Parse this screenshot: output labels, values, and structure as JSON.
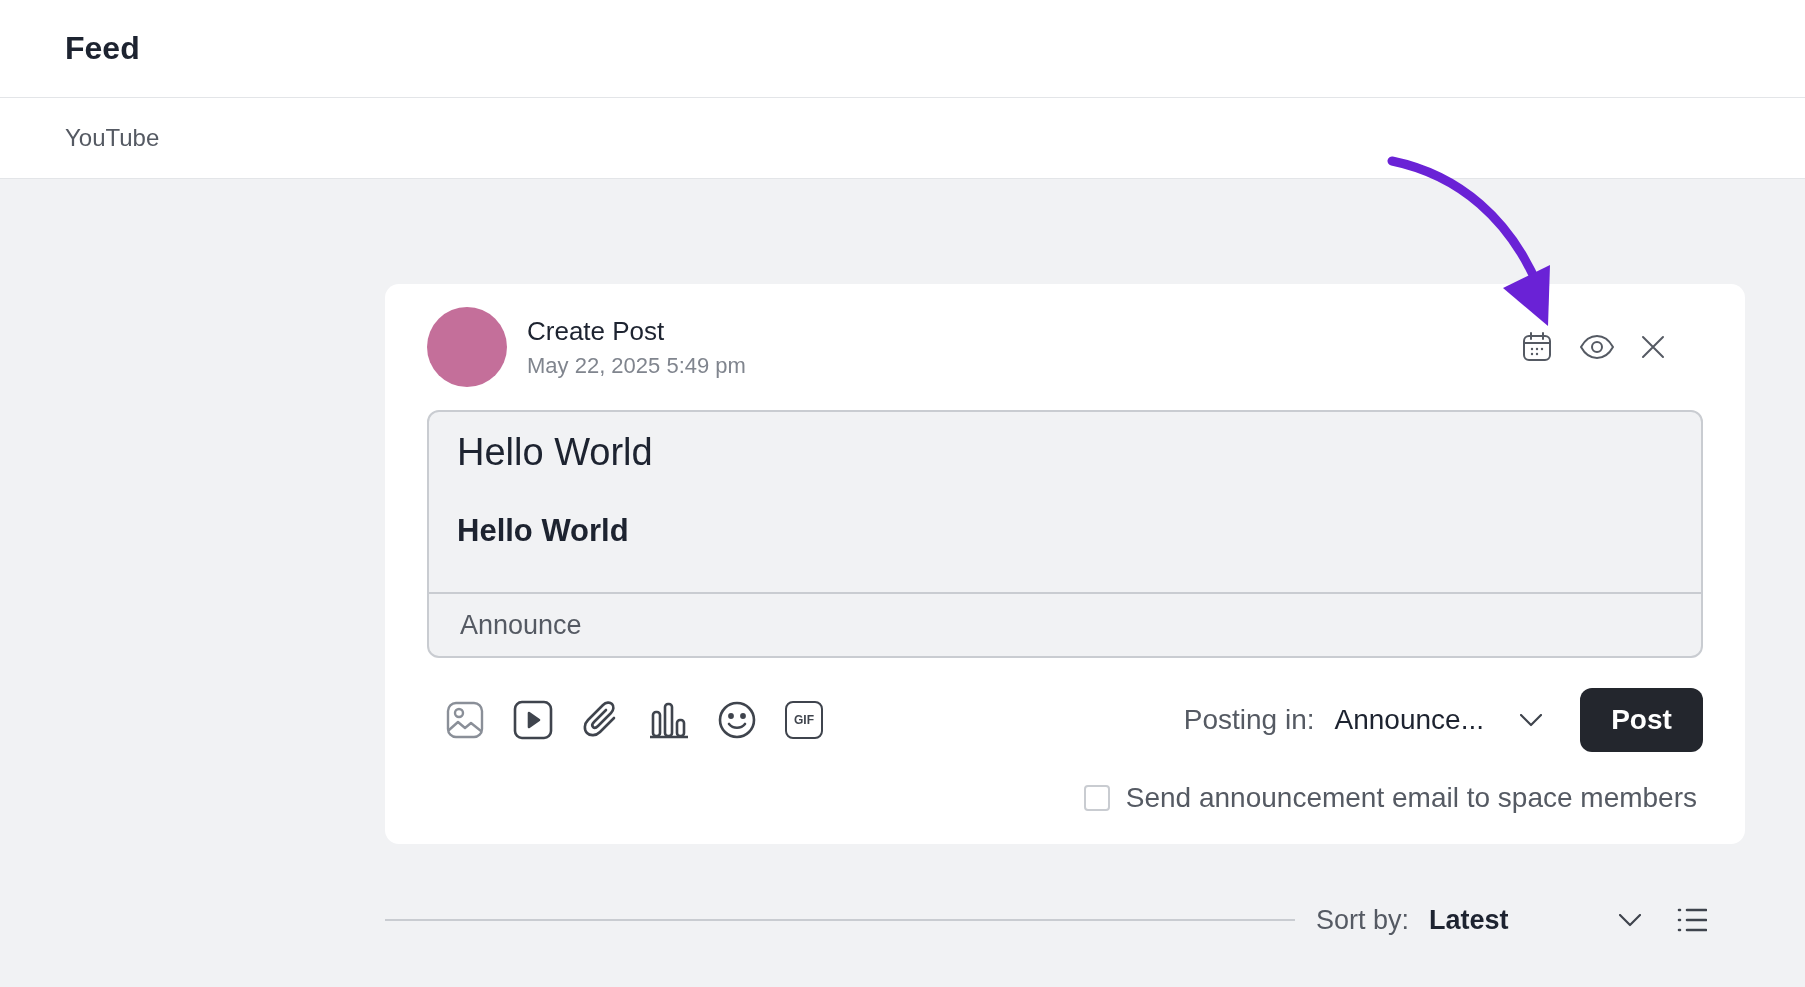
{
  "header": {
    "title": "Feed"
  },
  "subnav": {
    "label": "YouTube"
  },
  "composer": {
    "title": "Create Post",
    "timestamp": "May 22, 2025 5:49 pm",
    "header_actions": [
      {
        "kind": "schedule"
      },
      {
        "kind": "preview"
      },
      {
        "kind": "close"
      }
    ],
    "editor": {
      "heading": "Hello World",
      "body": "Hello World",
      "topic_field": {
        "value": "Announce"
      }
    },
    "toolbar": [
      {
        "kind": "image"
      },
      {
        "kind": "video"
      },
      {
        "kind": "attachment"
      },
      {
        "kind": "poll"
      },
      {
        "kind": "emoji"
      },
      {
        "kind": "gif",
        "label": "GIF"
      }
    ],
    "posting_in": {
      "label": "Posting in:",
      "value": "Announce..."
    },
    "post_button": "Post",
    "email_option": {
      "label": "Send announcement email to space members",
      "checked": false
    }
  },
  "sort": {
    "label": "Sort by:",
    "value": "Latest"
  }
}
